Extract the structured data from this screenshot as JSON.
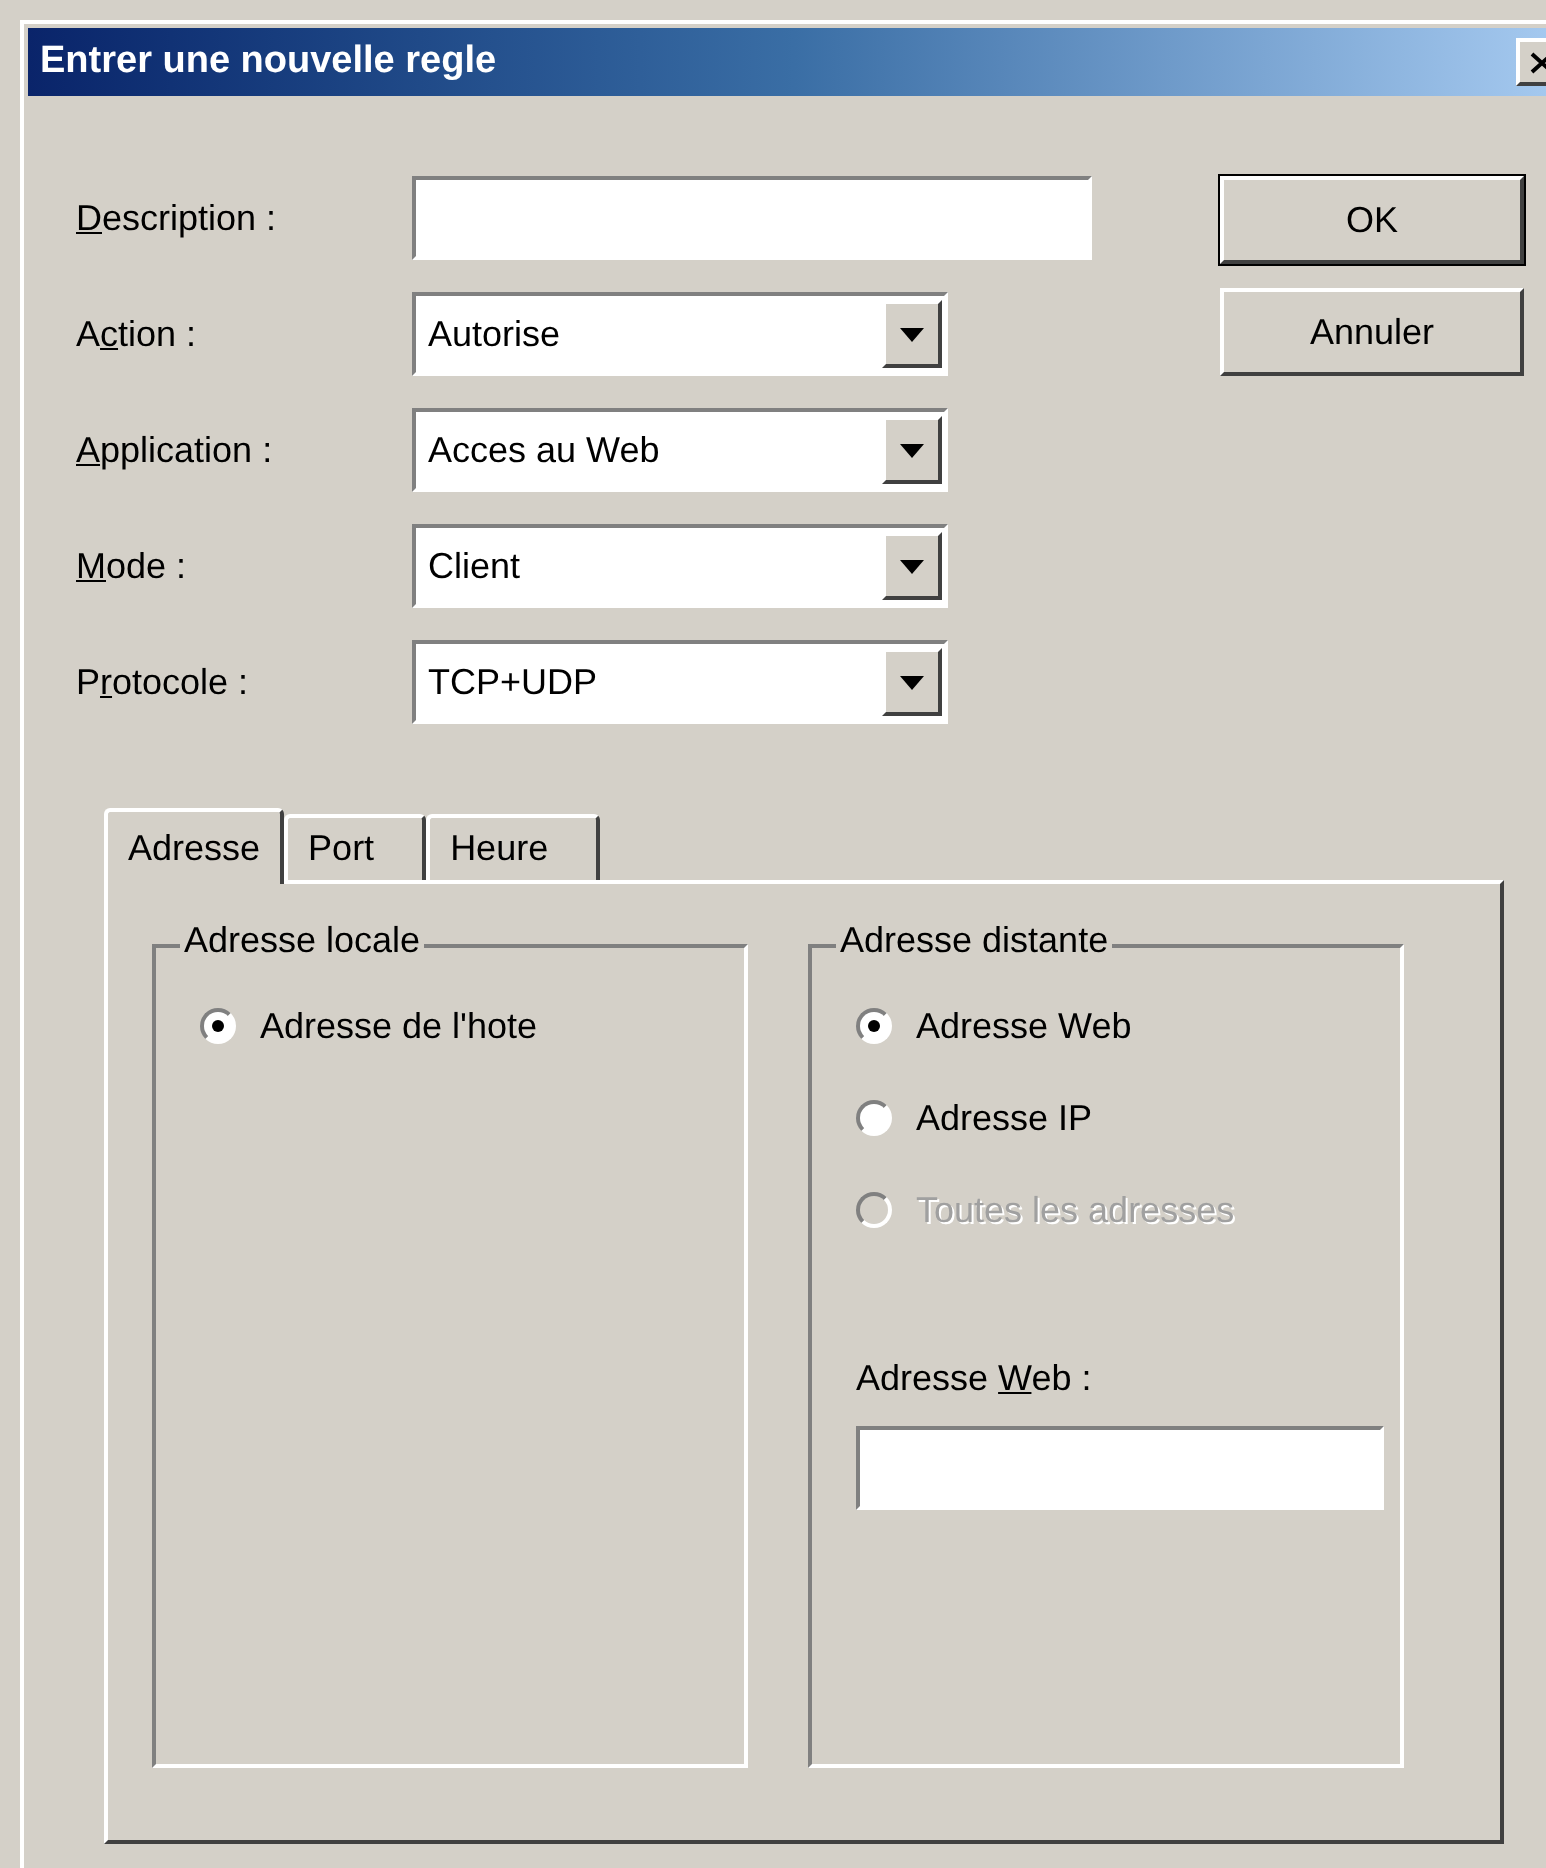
{
  "window": {
    "title": "Entrer une nouvelle regle"
  },
  "fields": [
    {
      "kind": "text",
      "label": {
        "key": "D",
        "post": "escription :"
      }
    },
    {
      "kind": "combo",
      "label": {
        "pre": "A",
        "key": "c",
        "post": "tion :"
      },
      "value": "Autorise"
    },
    {
      "kind": "combo",
      "label": {
        "key": "A",
        "post": "pplication :"
      },
      "value": "Acces au Web"
    },
    {
      "kind": "combo",
      "label": {
        "key": "M",
        "post": "ode :"
      },
      "value": "Client"
    },
    {
      "kind": "combo",
      "label": {
        "pre": "P",
        "key": "r",
        "post": "otocole :"
      },
      "value": "TCP+UDP"
    }
  ],
  "buttons": [
    {
      "label": "OK",
      "default": true
    },
    {
      "label": "Annuler",
      "default": false
    }
  ],
  "tabs": [
    {
      "label": "Adresse",
      "selected": true
    },
    {
      "label": "Port",
      "selected": false
    },
    {
      "label": "Heure",
      "selected": false
    }
  ],
  "groups": [
    {
      "title": "Adresse locale",
      "radios": [
        {
          "label": "Adresse de l'hote",
          "selected": true,
          "disabled": false
        }
      ]
    },
    {
      "title": "Adresse distante",
      "radios": [
        {
          "label": "Adresse Web",
          "selected": true,
          "disabled": false
        },
        {
          "label": "Adresse IP",
          "selected": false,
          "disabled": false
        },
        {
          "label": "Toutes les adresses",
          "selected": false,
          "disabled": true
        }
      ],
      "web_address": {
        "label": {
          "pre": "Adresse ",
          "key": "W",
          "post": "eb :"
        }
      }
    }
  ]
}
